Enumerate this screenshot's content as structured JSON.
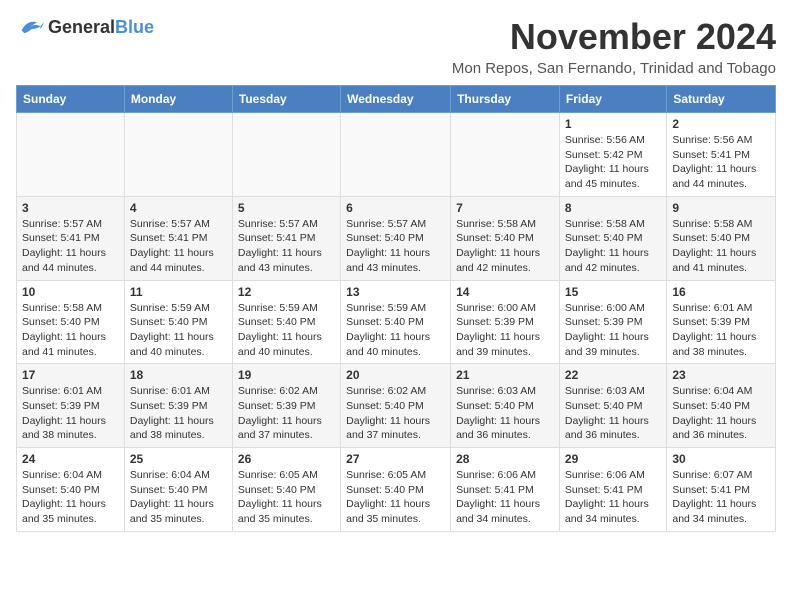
{
  "logo": {
    "general": "General",
    "blue": "Blue"
  },
  "title": "November 2024",
  "subtitle": "Mon Repos, San Fernando, Trinidad and Tobago",
  "headers": [
    "Sunday",
    "Monday",
    "Tuesday",
    "Wednesday",
    "Thursday",
    "Friday",
    "Saturday"
  ],
  "weeks": [
    [
      {
        "day": "",
        "info": ""
      },
      {
        "day": "",
        "info": ""
      },
      {
        "day": "",
        "info": ""
      },
      {
        "day": "",
        "info": ""
      },
      {
        "day": "",
        "info": ""
      },
      {
        "day": "1",
        "info": "Sunrise: 5:56 AM\nSunset: 5:42 PM\nDaylight: 11 hours and 45 minutes."
      },
      {
        "day": "2",
        "info": "Sunrise: 5:56 AM\nSunset: 5:41 PM\nDaylight: 11 hours and 44 minutes."
      }
    ],
    [
      {
        "day": "3",
        "info": "Sunrise: 5:57 AM\nSunset: 5:41 PM\nDaylight: 11 hours and 44 minutes."
      },
      {
        "day": "4",
        "info": "Sunrise: 5:57 AM\nSunset: 5:41 PM\nDaylight: 11 hours and 44 minutes."
      },
      {
        "day": "5",
        "info": "Sunrise: 5:57 AM\nSunset: 5:41 PM\nDaylight: 11 hours and 43 minutes."
      },
      {
        "day": "6",
        "info": "Sunrise: 5:57 AM\nSunset: 5:40 PM\nDaylight: 11 hours and 43 minutes."
      },
      {
        "day": "7",
        "info": "Sunrise: 5:58 AM\nSunset: 5:40 PM\nDaylight: 11 hours and 42 minutes."
      },
      {
        "day": "8",
        "info": "Sunrise: 5:58 AM\nSunset: 5:40 PM\nDaylight: 11 hours and 42 minutes."
      },
      {
        "day": "9",
        "info": "Sunrise: 5:58 AM\nSunset: 5:40 PM\nDaylight: 11 hours and 41 minutes."
      }
    ],
    [
      {
        "day": "10",
        "info": "Sunrise: 5:58 AM\nSunset: 5:40 PM\nDaylight: 11 hours and 41 minutes."
      },
      {
        "day": "11",
        "info": "Sunrise: 5:59 AM\nSunset: 5:40 PM\nDaylight: 11 hours and 40 minutes."
      },
      {
        "day": "12",
        "info": "Sunrise: 5:59 AM\nSunset: 5:40 PM\nDaylight: 11 hours and 40 minutes."
      },
      {
        "day": "13",
        "info": "Sunrise: 5:59 AM\nSunset: 5:40 PM\nDaylight: 11 hours and 40 minutes."
      },
      {
        "day": "14",
        "info": "Sunrise: 6:00 AM\nSunset: 5:39 PM\nDaylight: 11 hours and 39 minutes."
      },
      {
        "day": "15",
        "info": "Sunrise: 6:00 AM\nSunset: 5:39 PM\nDaylight: 11 hours and 39 minutes."
      },
      {
        "day": "16",
        "info": "Sunrise: 6:01 AM\nSunset: 5:39 PM\nDaylight: 11 hours and 38 minutes."
      }
    ],
    [
      {
        "day": "17",
        "info": "Sunrise: 6:01 AM\nSunset: 5:39 PM\nDaylight: 11 hours and 38 minutes."
      },
      {
        "day": "18",
        "info": "Sunrise: 6:01 AM\nSunset: 5:39 PM\nDaylight: 11 hours and 38 minutes."
      },
      {
        "day": "19",
        "info": "Sunrise: 6:02 AM\nSunset: 5:39 PM\nDaylight: 11 hours and 37 minutes."
      },
      {
        "day": "20",
        "info": "Sunrise: 6:02 AM\nSunset: 5:40 PM\nDaylight: 11 hours and 37 minutes."
      },
      {
        "day": "21",
        "info": "Sunrise: 6:03 AM\nSunset: 5:40 PM\nDaylight: 11 hours and 36 minutes."
      },
      {
        "day": "22",
        "info": "Sunrise: 6:03 AM\nSunset: 5:40 PM\nDaylight: 11 hours and 36 minutes."
      },
      {
        "day": "23",
        "info": "Sunrise: 6:04 AM\nSunset: 5:40 PM\nDaylight: 11 hours and 36 minutes."
      }
    ],
    [
      {
        "day": "24",
        "info": "Sunrise: 6:04 AM\nSunset: 5:40 PM\nDaylight: 11 hours and 35 minutes."
      },
      {
        "day": "25",
        "info": "Sunrise: 6:04 AM\nSunset: 5:40 PM\nDaylight: 11 hours and 35 minutes."
      },
      {
        "day": "26",
        "info": "Sunrise: 6:05 AM\nSunset: 5:40 PM\nDaylight: 11 hours and 35 minutes."
      },
      {
        "day": "27",
        "info": "Sunrise: 6:05 AM\nSunset: 5:40 PM\nDaylight: 11 hours and 35 minutes."
      },
      {
        "day": "28",
        "info": "Sunrise: 6:06 AM\nSunset: 5:41 PM\nDaylight: 11 hours and 34 minutes."
      },
      {
        "day": "29",
        "info": "Sunrise: 6:06 AM\nSunset: 5:41 PM\nDaylight: 11 hours and 34 minutes."
      },
      {
        "day": "30",
        "info": "Sunrise: 6:07 AM\nSunset: 5:41 PM\nDaylight: 11 hours and 34 minutes."
      }
    ]
  ]
}
